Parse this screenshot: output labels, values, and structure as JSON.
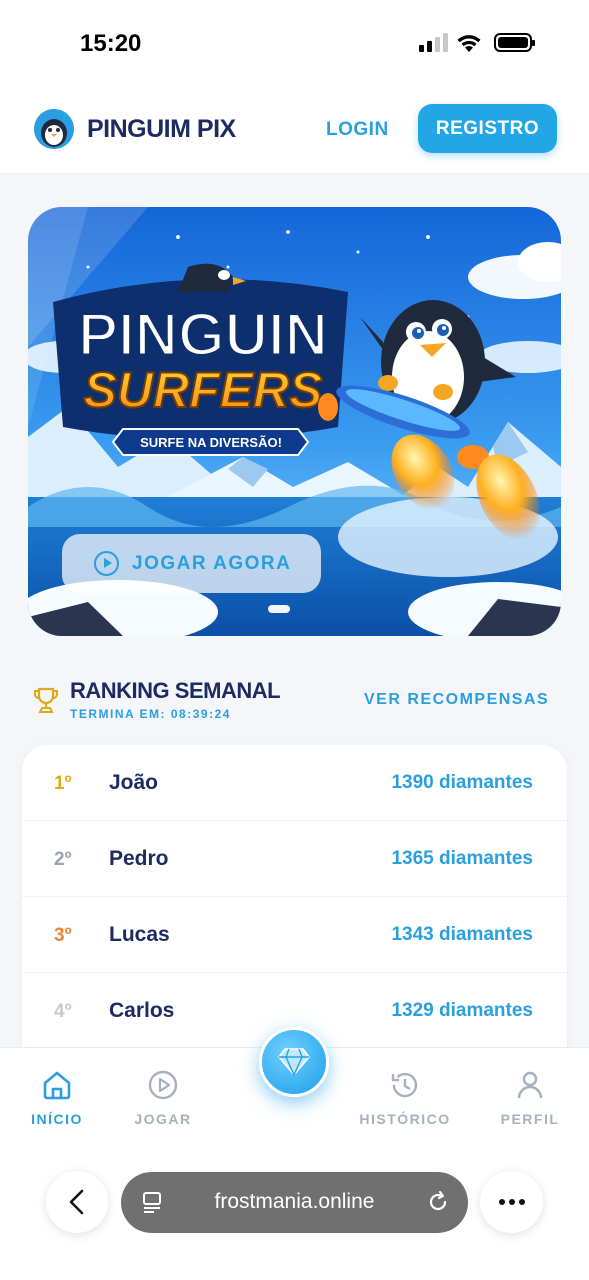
{
  "status_bar": {
    "time": "15:20"
  },
  "header": {
    "brand": "PINGUIM PIX",
    "login_label": "LOGIN",
    "register_label": "REGISTRO"
  },
  "banner": {
    "title_line1": "PINGUIN",
    "title_line2": "SURFERS",
    "tagline": "SURFE NA DIVERSÃO!",
    "play_label": "JOGAR AGORA"
  },
  "ranking": {
    "title": "RANKING SEMANAL",
    "ends_label": "TERMINA EM: 08:39:24",
    "rewards_label": "VER RECOMPENSAS",
    "rows": [
      {
        "position": "1º",
        "name": "João",
        "score": "1390 diamantes",
        "color": "#e2a916"
      },
      {
        "position": "2º",
        "name": "Pedro",
        "score": "1365 diamantes",
        "color": "#9aa4b5"
      },
      {
        "position": "3º",
        "name": "Lucas",
        "score": "1343 diamantes",
        "color": "#e9853a"
      },
      {
        "position": "4º",
        "name": "Carlos",
        "score": "1329 diamantes",
        "color": "#c3cad6"
      }
    ]
  },
  "nav": {
    "items": [
      {
        "label": "INÍCIO",
        "icon": "home-icon",
        "active": true
      },
      {
        "label": "JOGAR",
        "icon": "play-icon",
        "active": false
      },
      {
        "label": "HISTÓRICO",
        "icon": "history-icon",
        "active": false
      },
      {
        "label": "PERFIL",
        "icon": "user-icon",
        "active": false
      }
    ],
    "center_icon": "diamond-icon"
  },
  "browser": {
    "url": "frostmania.online"
  },
  "colors": {
    "accent": "#2a9fe0",
    "brand_dark": "#1c2c63",
    "register_bg": "#22a7e6"
  }
}
